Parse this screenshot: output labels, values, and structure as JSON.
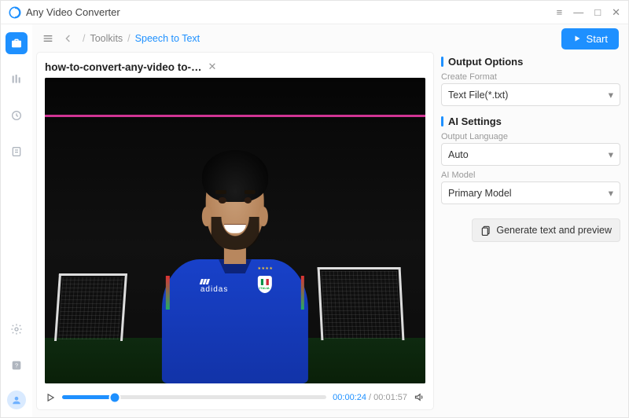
{
  "app": {
    "title": "Any Video Converter"
  },
  "breadcrumb": {
    "items": [
      "Toolkits",
      "Speech to Text"
    ]
  },
  "start_button": "Start",
  "file": {
    "name": "how-to-convert-any-video to-…"
  },
  "playback": {
    "current": "00:00:24",
    "duration": "00:01:57",
    "progress_pct": 20
  },
  "output": {
    "section_title": "Output Options",
    "format_label": "Create Format",
    "format_value": "Text File(*.txt)"
  },
  "ai": {
    "section_title": "AI Settings",
    "lang_label": "Output Language",
    "lang_value": "Auto",
    "model_label": "AI Model",
    "model_value": "Primary Model"
  },
  "generate_button": "Generate text and preview",
  "jersey": {
    "brand": "adidas",
    "crest_text": "ITALIA"
  }
}
